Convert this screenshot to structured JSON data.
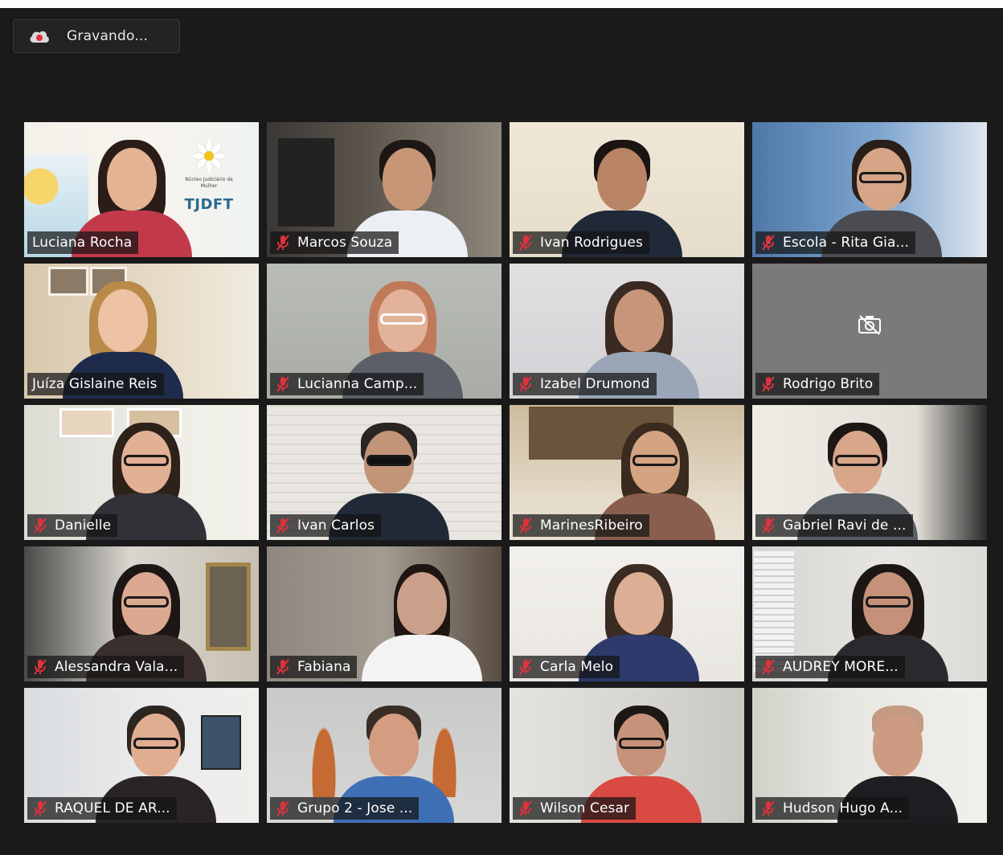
{
  "recording": {
    "label": "Gravando..."
  },
  "colors": {
    "active_speaker_border": "#e6f05a",
    "mute_icon": "#e0323c",
    "background": "#1a1a1a"
  },
  "tiles": [
    {
      "name": "Luciana Rocha",
      "muted": false,
      "speaking": true,
      "video": true,
      "logo": {
        "small_text": "Núcleo Judiciário da Mulher",
        "org": "TJDFT"
      }
    },
    {
      "name": "Marcos Souza",
      "muted": true,
      "speaking": false,
      "video": true
    },
    {
      "name": "Ivan Rodrigues",
      "muted": true,
      "speaking": false,
      "video": true
    },
    {
      "name": "Escola - Rita Gia...",
      "muted": true,
      "speaking": false,
      "video": true
    },
    {
      "name": "Juíza Gislaine Reis",
      "muted": false,
      "speaking": false,
      "video": true
    },
    {
      "name": "Lucianna Camp...",
      "muted": true,
      "speaking": false,
      "video": true
    },
    {
      "name": "Izabel Drumond",
      "muted": true,
      "speaking": false,
      "video": true
    },
    {
      "name": "Rodrigo Brito",
      "muted": true,
      "speaking": false,
      "video": false
    },
    {
      "name": "Danielle",
      "muted": true,
      "speaking": false,
      "video": true
    },
    {
      "name": "Ivan Carlos",
      "muted": true,
      "speaking": false,
      "video": true
    },
    {
      "name": "MarinesRibeiro",
      "muted": true,
      "speaking": false,
      "video": true
    },
    {
      "name": "Gabriel Ravi de ...",
      "muted": true,
      "speaking": false,
      "video": true
    },
    {
      "name": "Alessandra Vala...",
      "muted": true,
      "speaking": false,
      "video": true
    },
    {
      "name": "Fabiana",
      "muted": true,
      "speaking": false,
      "video": true
    },
    {
      "name": "Carla Melo",
      "muted": true,
      "speaking": false,
      "video": true
    },
    {
      "name": "AUDREY MORE...",
      "muted": true,
      "speaking": false,
      "video": true
    },
    {
      "name": "RAQUEL DE AR...",
      "muted": true,
      "speaking": false,
      "video": true
    },
    {
      "name": "Grupo 2 - Jose ...",
      "muted": true,
      "speaking": false,
      "video": true
    },
    {
      "name": "Wilson Cesar",
      "muted": true,
      "speaking": false,
      "video": true
    },
    {
      "name": "Hudson Hugo A...",
      "muted": true,
      "speaking": false,
      "video": true
    }
  ]
}
